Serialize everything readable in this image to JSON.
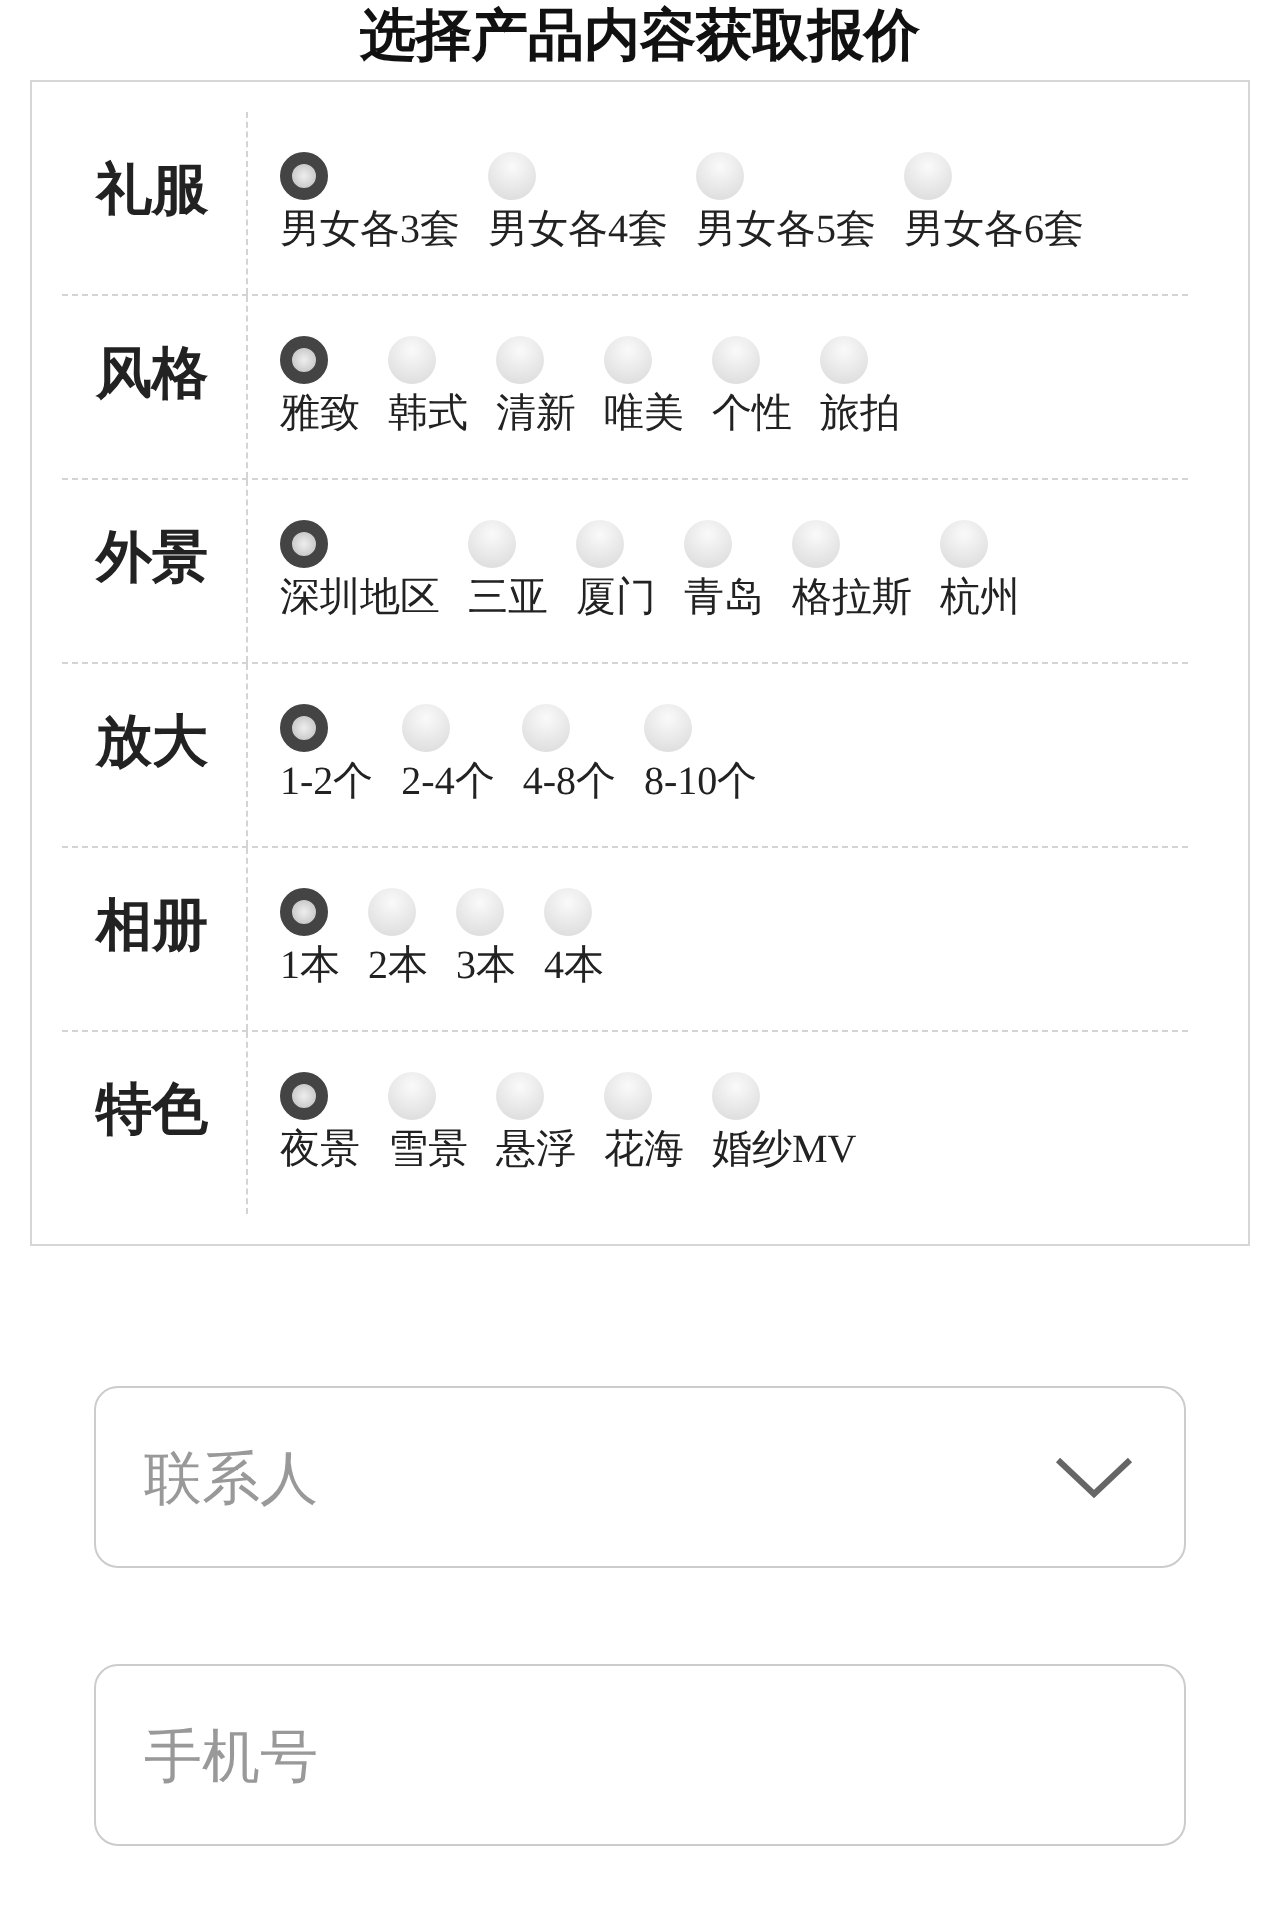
{
  "title": "选择产品内容获取报价",
  "groups": [
    {
      "label": "礼服",
      "options": [
        {
          "label": "男女各3套",
          "selected": true
        },
        {
          "label": "男女各4套",
          "selected": false
        },
        {
          "label": "男女各5套",
          "selected": false
        },
        {
          "label": "男女各6套",
          "selected": false
        }
      ]
    },
    {
      "label": "风格",
      "options": [
        {
          "label": "雅致",
          "selected": true
        },
        {
          "label": "韩式",
          "selected": false
        },
        {
          "label": "清新",
          "selected": false
        },
        {
          "label": "唯美",
          "selected": false
        },
        {
          "label": "个性",
          "selected": false
        },
        {
          "label": "旅拍",
          "selected": false
        }
      ]
    },
    {
      "label": "外景",
      "options": [
        {
          "label": "深圳地区",
          "selected": true
        },
        {
          "label": "三亚",
          "selected": false
        },
        {
          "label": "厦门",
          "selected": false
        },
        {
          "label": "青岛",
          "selected": false
        },
        {
          "label": "格拉斯",
          "selected": false
        },
        {
          "label": "杭州",
          "selected": false
        }
      ]
    },
    {
      "label": "放大",
      "options": [
        {
          "label": "1-2个",
          "selected": true
        },
        {
          "label": "2-4个",
          "selected": false
        },
        {
          "label": "4-8个",
          "selected": false
        },
        {
          "label": "8-10个",
          "selected": false
        }
      ]
    },
    {
      "label": "相册",
      "options": [
        {
          "label": "1本",
          "selected": true
        },
        {
          "label": "2本",
          "selected": false
        },
        {
          "label": "3本",
          "selected": false
        },
        {
          "label": "4本",
          "selected": false
        }
      ]
    },
    {
      "label": "特色",
      "options": [
        {
          "label": "夜景",
          "selected": true
        },
        {
          "label": "雪景",
          "selected": false
        },
        {
          "label": "悬浮",
          "selected": false
        },
        {
          "label": "花海",
          "selected": false
        },
        {
          "label": "婚纱MV",
          "selected": false
        }
      ]
    }
  ],
  "fields": [
    {
      "kind": "select",
      "placeholder": "联系人"
    },
    {
      "kind": "text",
      "placeholder": "手机号"
    }
  ]
}
